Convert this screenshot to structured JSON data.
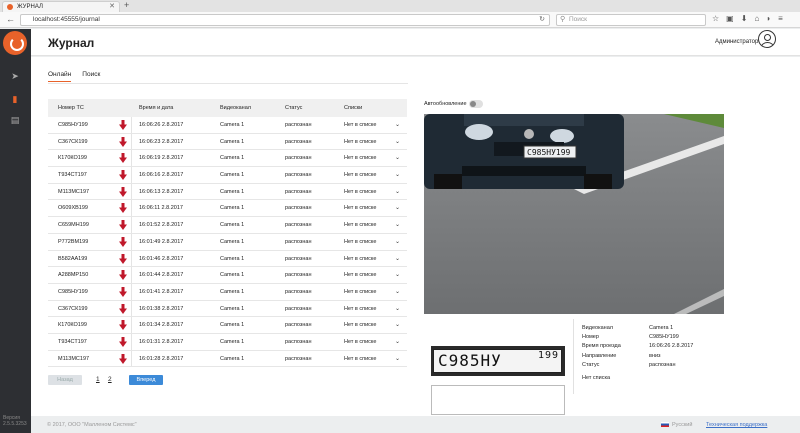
{
  "browser": {
    "tab_title": "ЖУРНАЛ",
    "url": "localhost:45555/journal",
    "search_placeholder": "Поиск"
  },
  "sidebar": {
    "version_label": "Версия",
    "version_number": "2.5.5.3253"
  },
  "header": {
    "title": "Журнал",
    "user": "Администратор"
  },
  "tabs": [
    "Онлайн",
    "Поиск"
  ],
  "table": {
    "columns": [
      "Номер ТС",
      "Время и дата",
      "Видеоканал",
      "Статус",
      "Списки"
    ],
    "rows": [
      {
        "plate": "С985НУ199",
        "time": "16:06:26 2.8.2017",
        "camera": "Camera 1",
        "status": "распознан",
        "list": "Нет в списке"
      },
      {
        "plate": "С367СК199",
        "time": "16:06:23 2.8.2017",
        "camera": "Camera 1",
        "status": "распознан",
        "list": "Нет в списке"
      },
      {
        "plate": "К170КО199",
        "time": "16:06:19 2.8.2017",
        "camera": "Camera 1",
        "status": "распознан",
        "list": "Нет в списке"
      },
      {
        "plate": "Т934СТ197",
        "time": "16:06:16 2.8.2017",
        "camera": "Camera 1",
        "status": "распознан",
        "list": "Нет в списке"
      },
      {
        "plate": "М113МС197",
        "time": "16:06:13 2.8.2017",
        "camera": "Camera 1",
        "status": "распознан",
        "list": "Нет в списке"
      },
      {
        "plate": "О609ХВ199",
        "time": "16:06:11 2.8.2017",
        "camera": "Camera 1",
        "status": "распознан",
        "list": "Нет в списке"
      },
      {
        "plate": "С659МН199",
        "time": "16:01:52 2.8.2017",
        "camera": "Camera 1",
        "status": "распознан",
        "list": "Нет в списке"
      },
      {
        "plate": "Р772ВМ199",
        "time": "16:01:49 2.8.2017",
        "camera": "Camera 1",
        "status": "распознан",
        "list": "Нет в списке"
      },
      {
        "plate": "В582АА199",
        "time": "16:01:46 2.8.2017",
        "camera": "Camera 1",
        "status": "распознан",
        "list": "Нет в списке"
      },
      {
        "plate": "А288МР150",
        "time": "16:01:44 2.8.2017",
        "camera": "Camera 1",
        "status": "распознан",
        "list": "Нет в списке"
      },
      {
        "plate": "С985НУ199",
        "time": "16:01:41 2.8.2017",
        "camera": "Camera 1",
        "status": "распознан",
        "list": "Нет в списке"
      },
      {
        "plate": "С367СК199",
        "time": "16:01:38 2.8.2017",
        "camera": "Camera 1",
        "status": "распознан",
        "list": "Нет в списке"
      },
      {
        "plate": "К170КО199",
        "time": "16:01:34 2.8.2017",
        "camera": "Camera 1",
        "status": "распознан",
        "list": "Нет в списке"
      },
      {
        "plate": "Т934СТ197",
        "time": "16:01:31 2.8.2017",
        "camera": "Camera 1",
        "status": "распознан",
        "list": "Нет в списке"
      },
      {
        "plate": "М113МС197",
        "time": "16:01:28 2.8.2017",
        "camera": "Camera 1",
        "status": "распознан",
        "list": "Нет в списке"
      }
    ]
  },
  "pager": {
    "prev": "Назад",
    "pages": [
      "1",
      "2"
    ],
    "next": "Вперед"
  },
  "auto_update_label": "Автообновление",
  "auto_update_on": false,
  "plate_image_text": "С985НУ",
  "plate_image_region": "199",
  "details": [
    {
      "label": "Видеоканал",
      "value": "Camera 1"
    },
    {
      "label": "Номер",
      "value": "С985НУ199"
    },
    {
      "label": "Время проезда",
      "value": "16:06:26 2.8.2017"
    },
    {
      "label": "Направление",
      "value": "вниз"
    },
    {
      "label": "Статус",
      "value": "распознан"
    },
    {
      "label": "Нет списка",
      "value": ""
    }
  ],
  "footer": {
    "copyright": "© 2017, ООО \"Малленом Системс\"",
    "language": "Русский",
    "support": "Техническая поддержка"
  },
  "colors": {
    "accent": "#e8622a",
    "arrow": "#c0182b",
    "primary_button": "#3c8ad8",
    "sidebar": "#2d2f33"
  }
}
